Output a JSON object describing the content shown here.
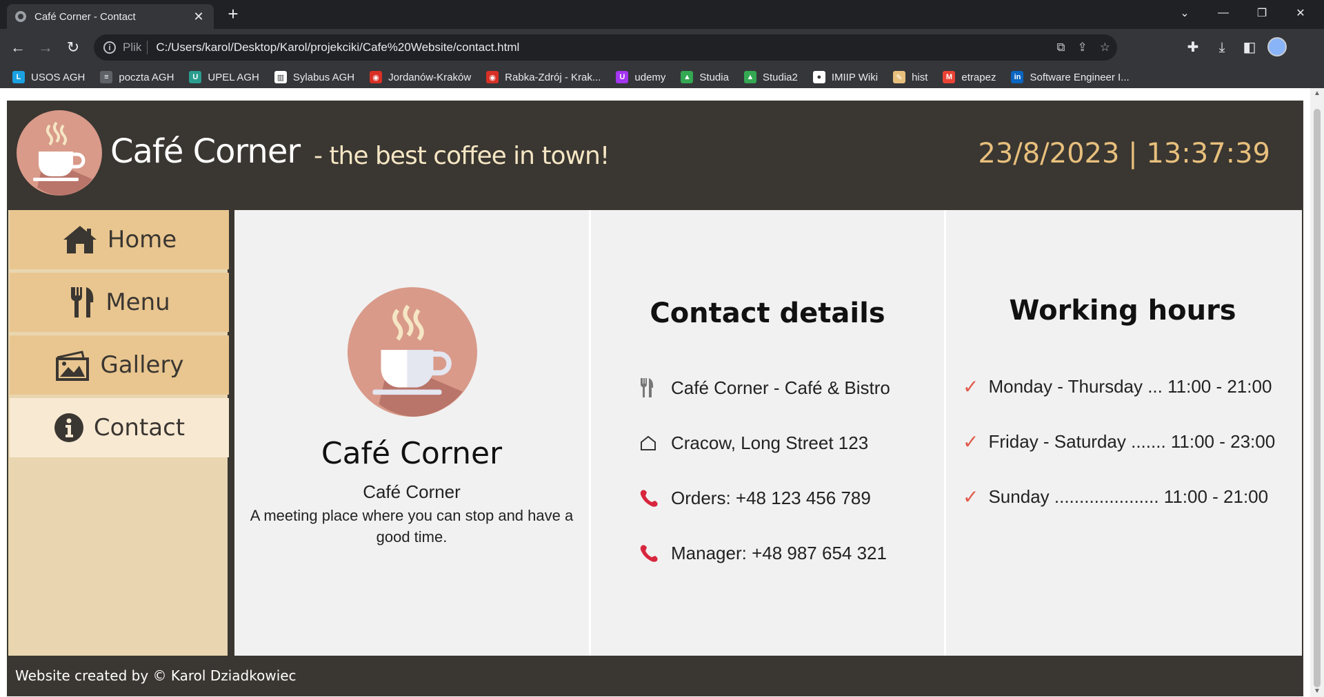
{
  "browser": {
    "tab_title": "Café Corner - Contact",
    "address_prefix": "Plik",
    "address_url": "C:/Users/karol/Desktop/Karol/projekciki/Cafe%20Website/contact.html",
    "bookmarks": [
      {
        "label": "USOS AGH",
        "icon": "usos-icon",
        "color": "#1ba1e2",
        "glyph": "L"
      },
      {
        "label": "poczta AGH",
        "icon": "mail-icon",
        "color": "#5f6368",
        "glyph": "≡"
      },
      {
        "label": "UPEL AGH",
        "icon": "upel-icon",
        "color": "#2a9d8f",
        "glyph": "U"
      },
      {
        "label": "Sylabus AGH",
        "icon": "sylabus-icon",
        "color": "#ffffff",
        "glyph": "▥"
      },
      {
        "label": "Jordanów-Kraków",
        "icon": "bus-icon",
        "color": "#d93025",
        "glyph": "◉"
      },
      {
        "label": "Rabka-Zdrój - Krak...",
        "icon": "bus-icon",
        "color": "#d93025",
        "glyph": "◉"
      },
      {
        "label": "udemy",
        "icon": "udemy-icon",
        "color": "#a435f0",
        "glyph": "U"
      },
      {
        "label": "Studia",
        "icon": "drive-icon",
        "color": "#34a853",
        "glyph": "▲"
      },
      {
        "label": "Studia2",
        "icon": "drive-icon",
        "color": "#34a853",
        "glyph": "▲"
      },
      {
        "label": "IMIIP Wiki",
        "icon": "globe-icon",
        "color": "#ffffff",
        "glyph": "●"
      },
      {
        "label": "hist",
        "icon": "hist-icon",
        "color": "#e8c07d",
        "glyph": "✎"
      },
      {
        "label": "etrapez",
        "icon": "etrapez-icon",
        "color": "#ea4335",
        "glyph": "M"
      },
      {
        "label": "Software Engineer I...",
        "icon": "linkedin-icon",
        "color": "#0a66c2",
        "glyph": "in"
      }
    ]
  },
  "site": {
    "brand": "Café Corner",
    "tagline": "- the best coffee in town!",
    "datetime": "23/8/2023 | 13:37:39",
    "nav": [
      {
        "label": "Home",
        "icon": "home-icon"
      },
      {
        "label": "Menu",
        "icon": "utensils-icon"
      },
      {
        "label": "Gallery",
        "icon": "gallery-icon"
      },
      {
        "label": "Contact",
        "icon": "info-icon",
        "active": true
      }
    ],
    "about": {
      "title": "Café Corner",
      "subtitle": "Café Corner",
      "description": "A meeting place where you can stop and have a good time."
    },
    "contact": {
      "heading": "Contact details",
      "items": [
        {
          "icon": "utensils-icon",
          "text": "Café Corner - Café & Bistro"
        },
        {
          "icon": "house-icon",
          "text": "Cracow, Long Street 123"
        },
        {
          "icon": "phone-icon",
          "text": "Orders: +48 123 456 789"
        },
        {
          "icon": "phone-icon",
          "text": "Manager: +48 987 654 321"
        }
      ]
    },
    "hours": {
      "heading": "Working hours",
      "items": [
        {
          "text": "Monday - Thursday ... 11:00 - 21:00"
        },
        {
          "text": "Friday - Saturday ....... 11:00 - 23:00"
        },
        {
          "text": "Sunday ..................... 11:00 - 21:00"
        }
      ]
    },
    "footer": "Website created by © Karol Dziadkowiec"
  },
  "colors": {
    "header_bg": "#3a3631",
    "nav_bg": "#e9c690",
    "nav_active": "#f8e9d3",
    "accent": "#e8c07d",
    "check": "#e05a4c",
    "phone": "#d7263d"
  }
}
